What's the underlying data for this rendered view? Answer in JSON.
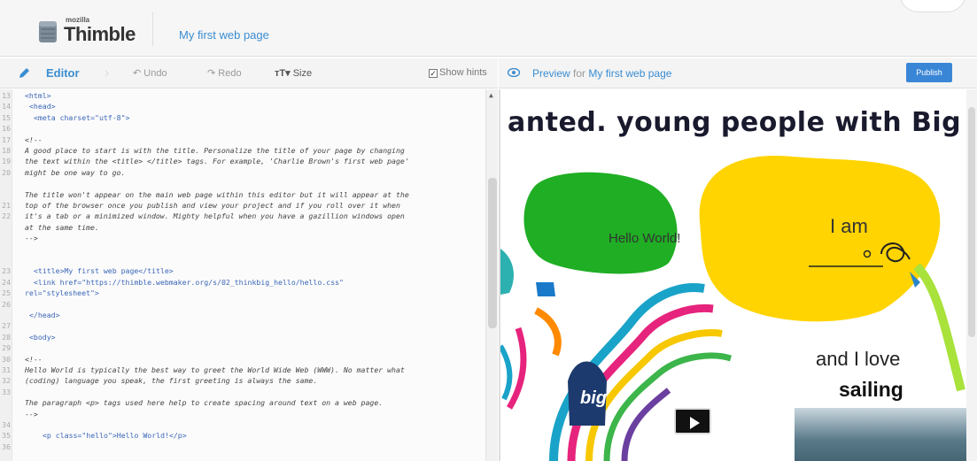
{
  "app": {
    "logo_small": "mozilla",
    "logo_name": "Thimble",
    "project_title": "My first web page"
  },
  "editor_toolbar": {
    "editor_label": "Editor",
    "undo_label": "Undo",
    "redo_label": "Redo",
    "size_label": "Size",
    "show_hints_label": "Show hints",
    "show_hints_checked": true
  },
  "preview_toolbar": {
    "preview_label": "Preview",
    "for_text": "for",
    "project_name": "My first web page",
    "publish_label": "Publish"
  },
  "code_lines": [
    {
      "n": "13",
      "t": "<html>",
      "k": "tag",
      "i": 0
    },
    {
      "n": "14",
      "t": "<head>",
      "k": "tag",
      "i": 1
    },
    {
      "n": "15",
      "t": "<meta charset=\"utf-8\">",
      "k": "tag",
      "i": 2
    },
    {
      "n": "16",
      "t": "",
      "k": "plain",
      "i": 0
    },
    {
      "n": "17",
      "t": "<!--",
      "k": "comment",
      "i": 0
    },
    {
      "n": "18",
      "t": "A good place to start is with the title. Personalize the title of your page by changing",
      "k": "comment",
      "i": 0
    },
    {
      "n": "19",
      "t": "the text within the <title> </title> tags. For example, 'Charlie Brown's first web page'",
      "k": "comment",
      "i": 0
    },
    {
      "n": "20",
      "t": "might be one way to go.",
      "k": "comment",
      "i": 0
    },
    {
      "n": "",
      "t": "",
      "k": "plain",
      "i": 0
    },
    {
      "n": "",
      "t": "The title won't appear on the main web page within this editor but it will appear at the",
      "k": "comment",
      "i": 0
    },
    {
      "n": "21",
      "t": "top of the browser once you publish and view your project and if you roll over it when",
      "k": "comment",
      "i": 0
    },
    {
      "n": "22",
      "t": "it's a tab or a minimized window. Mighty helpful when you have a gazillion windows open",
      "k": "comment",
      "i": 0
    },
    {
      "n": "",
      "t": "at the same time.",
      "k": "comment",
      "i": 0
    },
    {
      "n": "",
      "t": "-->",
      "k": "comment",
      "i": 0
    },
    {
      "n": "",
      "t": "",
      "k": "plain",
      "i": 0
    },
    {
      "n": "",
      "t": "",
      "k": "plain",
      "i": 0
    },
    {
      "n": "23",
      "t": "<title>My first web page</title>",
      "k": "tag",
      "i": 2
    },
    {
      "n": "24",
      "t": "<link href=\"https://thimble.webmaker.org/s/02_thinkbig_hello/hello.css\"",
      "k": "tag",
      "i": 2
    },
    {
      "n": "25",
      "t": "rel=\"stylesheet\">",
      "k": "tag",
      "i": 0
    },
    {
      "n": "26",
      "t": "",
      "k": "plain",
      "i": 0
    },
    {
      "n": "",
      "t": "</head>",
      "k": "tag",
      "i": 1
    },
    {
      "n": "27",
      "t": "",
      "k": "plain",
      "i": 0
    },
    {
      "n": "28",
      "t": "<body>",
      "k": "tag",
      "i": 1
    },
    {
      "n": "29",
      "t": "",
      "k": "plain",
      "i": 0
    },
    {
      "n": "30",
      "t": "<!--",
      "k": "comment",
      "i": 0
    },
    {
      "n": "31",
      "t": "Hello World is typically the best way to greet the World Wide Web (WWW). No matter what",
      "k": "comment",
      "i": 0
    },
    {
      "n": "32",
      "t": "(coding) language you speak, the first greeting is always the same.",
      "k": "comment",
      "i": 0
    },
    {
      "n": "33",
      "t": "",
      "k": "plain",
      "i": 0
    },
    {
      "n": "",
      "t": "The paragraph <p> tags used here help to create spacing around text on a web page.",
      "k": "comment",
      "i": 0
    },
    {
      "n": "",
      "t": "-->",
      "k": "comment",
      "i": 0
    },
    {
      "n": "34",
      "t": "",
      "k": "plain",
      "i": 0
    },
    {
      "n": "35",
      "t": "<p class=\"hello\">Hello World!</p>",
      "k": "tag",
      "i": 4
    },
    {
      "n": "36",
      "t": "",
      "k": "plain",
      "i": 0
    }
  ],
  "preview": {
    "banner": "anted. young people with Big ideas",
    "hello": "Hello World!",
    "i_am": "I am",
    "and_i_love": "and I love",
    "sailing": "sailing",
    "big_text": "big"
  },
  "colors": {
    "accent": "#3a8dd1",
    "green_blob": "#1fae24",
    "yellow_blob": "#ffd400",
    "publish": "#3a86d6"
  }
}
